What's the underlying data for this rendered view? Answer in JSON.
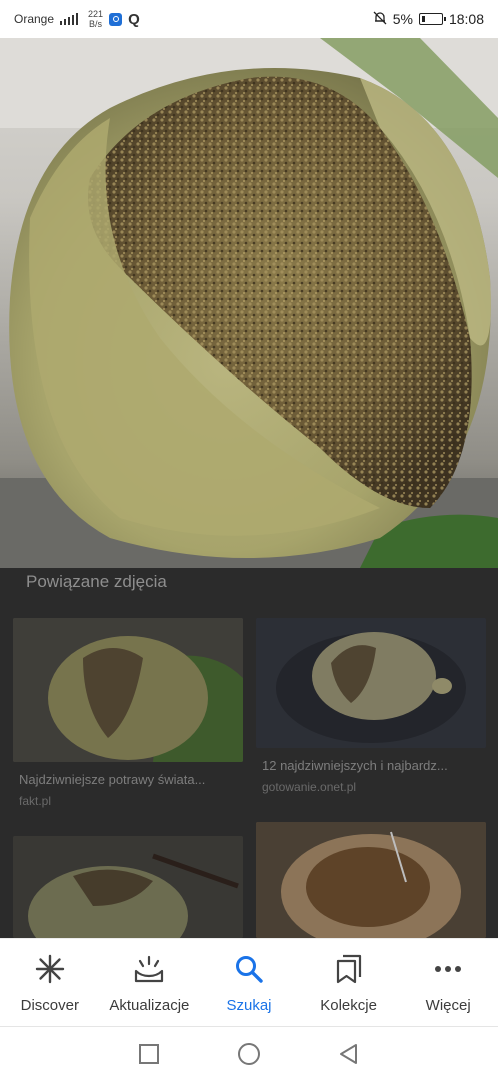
{
  "status_bar": {
    "carrier": "Orange",
    "network_speed_value": "221",
    "network_speed_unit": "B/s",
    "battery": "5%",
    "time": "18:08"
  },
  "hero_image": {
    "description_icon": "food-photo"
  },
  "related": {
    "title": "Powiązane zdjęcia",
    "cards": [
      {
        "title": "Najdziwniejsze potrawy świata...",
        "source": "fakt.pl"
      },
      {
        "title": "12 najdziwniejszych i najbardz...",
        "source": "gotowanie.onet.pl"
      },
      {
        "title": "",
        "source": ""
      },
      {
        "title": "",
        "source": ""
      }
    ]
  },
  "bottom_nav": {
    "items": [
      {
        "label": "Discover",
        "icon": "asterisk-icon",
        "active": false
      },
      {
        "label": "Aktualizacje",
        "icon": "updates-icon",
        "active": false
      },
      {
        "label": "Szukaj",
        "icon": "search-icon",
        "active": true
      },
      {
        "label": "Kolekcje",
        "icon": "collections-icon",
        "active": false
      },
      {
        "label": "Więcej",
        "icon": "more-icon",
        "active": false
      }
    ]
  },
  "colors": {
    "accent": "#1a73e8",
    "scrim": "#2b2b2b"
  }
}
